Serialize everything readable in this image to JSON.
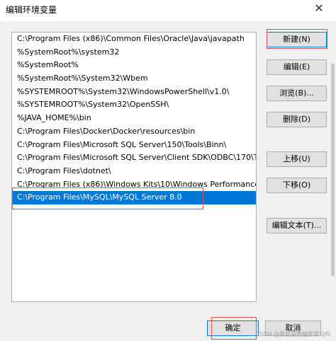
{
  "window": {
    "title": "编辑环境变量",
    "close_label": "✕"
  },
  "paths": [
    "C:\\Program Files (x86)\\Common Files\\Oracle\\Java\\javapath",
    "%SystemRoot%\\system32",
    "%SystemRoot%",
    "%SystemRoot%\\System32\\Wbem",
    "%SYSTEMROOT%\\System32\\WindowsPowerShell\\v1.0\\",
    "%SYSTEMROOT%\\System32\\OpenSSH\\",
    "%JAVA_HOME%\\bin",
    "C:\\Program Files\\Docker\\Docker\\resources\\bin",
    "C:\\Program Files\\Microsoft SQL Server\\150\\Tools\\Binn\\",
    "C:\\Program Files\\Microsoft SQL Server\\Client SDK\\ODBC\\170\\T...",
    "C:\\Program Files\\dotnet\\",
    "C:\\Program Files (x86)\\Windows Kits\\10\\Windows Performance ...",
    "C:\\Program Files\\MySQL\\MySQL Server 8.0"
  ],
  "selected_index": 12,
  "buttons": {
    "new": "新建(N)",
    "edit": "编辑(E)",
    "browse": "浏览(B)...",
    "delete": "删除(D)",
    "move_up": "上移(U)",
    "move_down": "下移(O)",
    "edit_text": "编辑文本(T)...",
    "ok": "确定",
    "cancel": "取消"
  },
  "watermark": "CSDN @那就是数据库学习吗"
}
